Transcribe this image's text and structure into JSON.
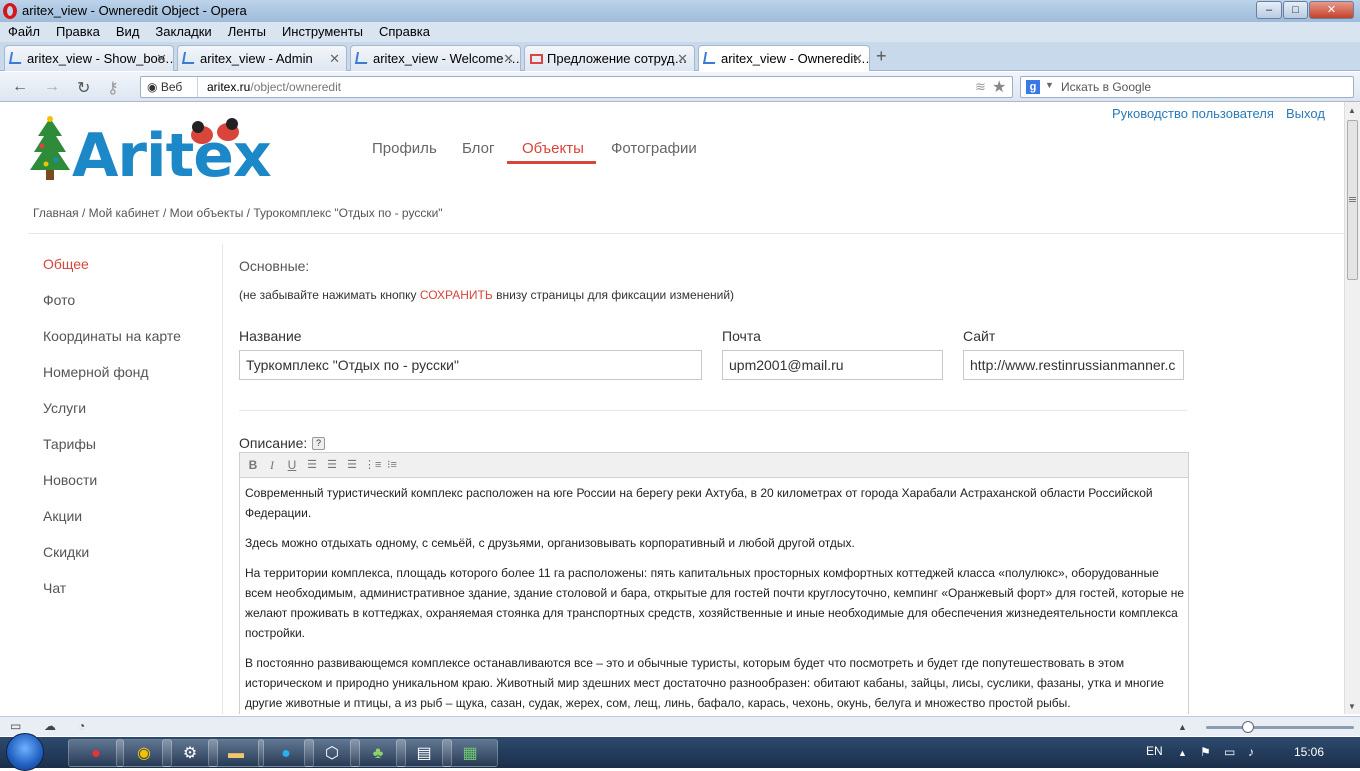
{
  "window": {
    "title": "aritex_view - Owneredit Object - Opera",
    "controls": {
      "minimize": "–",
      "maximize": "□",
      "close": "✕"
    }
  },
  "menu": [
    "Файл",
    "Правка",
    "Вид",
    "Закладки",
    "Ленты",
    "Инструменты",
    "Справка"
  ],
  "tabs": [
    {
      "label": "aritex_view - Show_boo…",
      "icon": "aritex-favicon"
    },
    {
      "label": "aritex_view - Admin",
      "icon": "aritex-favicon"
    },
    {
      "label": "aritex_view - Welcome …",
      "icon": "aritex-favicon"
    },
    {
      "label": "Предложение сотруд…",
      "icon": "gmail-favicon"
    },
    {
      "label": "aritex_view - Owneredit…",
      "icon": "aritex-favicon",
      "active": true
    }
  ],
  "address": {
    "security_label": "Веб",
    "host": "aritex.ru",
    "path": "/object/owneredit"
  },
  "search": {
    "placeholder": "Искать в Google",
    "engine_glyph": "g"
  },
  "site": {
    "logo_text": "Aritex",
    "nav": [
      "Профиль",
      "Блог",
      "Объекты",
      "Фотографии"
    ],
    "active_nav": "Объекты",
    "top_links": {
      "guide": "Руководство пользователя",
      "logout": "Выход"
    },
    "breadcrumb": "Главная / Мой кабинет / Мои объекты / Турокомплекс \"Отдых по - русски\"",
    "accent_color": "#d8453a",
    "link_color": "#2a7ab8"
  },
  "sidebar": [
    "Общее",
    "Фото",
    "Координаты на карте",
    "Номерной фонд",
    "Услуги",
    "Тарифы",
    "Новости",
    "Акции",
    "Скидки",
    "Чат"
  ],
  "form": {
    "section_title": "Основные:",
    "note_before": "(не забывайте нажимать кнопку ",
    "note_accent": "СОХРАНИТЬ",
    "note_after": " внизу страницы для фиксации изменений)",
    "name_label": "Название",
    "name_value": "Туркомплекс  \"Отдых по - русски\"",
    "email_label": "Почта",
    "email_value": "upm2001@mail.ru",
    "site_label": "Сайт",
    "site_value": "http://www.restinrussianmanner.c",
    "description_label": "Описание:",
    "help_glyph": "?"
  },
  "toolbar": [
    "B",
    "I",
    "U"
  ],
  "description": [
    "Современный туристический комплекс расположен на юге России на берегу реки Ахтуба, в 20 километрах от города Харабали Астраханской области Российской Федерации.",
    "Здесь можно отдыхать одному, с семьёй, с друзьями, организовывать корпоративный и любой другой отдых.",
    "На территории комплекса, площадь которого более 11 га расположены: пять капитальных просторных комфортных коттеджей класса «полулюкс», оборудованные всем необходимым, административное здание, здание столовой и бара, открытые для гостей почти круглосуточно, кемпинг «Оранжевый форт» для гостей, которые не желают проживать в коттеджах, охраняемая стоянка для транспортных средств, хозяйственные и иные необходимые для обеспечения жизнедеятельности комплекса постройки.",
    "В постоянно развивающемся комплексе останавливаются все – это и обычные туристы, которым будет что посмотреть и будет где попутешествовать в этом историческом и природно уникальном краю. Животный мир здешних мест достаточно разнообразен: обитают кабаны, зайцы, лисы, суслики, фазаны, утка и многие другие животные и птицы, а из рыб – щука, сазан, судак, жерех, сом, лещ, линь, бафало, карась, чехонь, окунь, белуга и множество простой рыбы."
  ],
  "taskbar": {
    "lang": "EN",
    "time": "15:06"
  }
}
